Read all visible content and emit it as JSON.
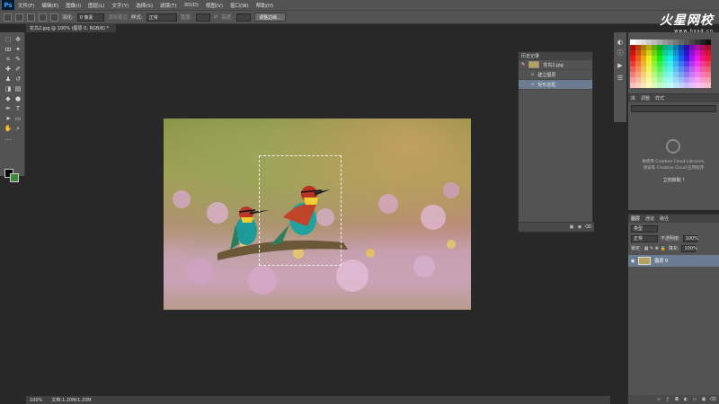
{
  "app": {
    "logo": "Ps"
  },
  "menu": [
    "文件(F)",
    "编辑(E)",
    "图像(I)",
    "图层(L)",
    "文字(Y)",
    "选择(S)",
    "滤镜(T)",
    "3D(D)",
    "视图(V)",
    "窗口(W)",
    "帮助(H)"
  ],
  "options": {
    "feather_label": "羽化:",
    "feather_value": "0 像素",
    "antialias_label": "消除锯齿",
    "style_label": "样式:",
    "style_value": "正常",
    "width_label": "宽度:",
    "height_label": "高度:",
    "refine_button": "调整边缘..."
  },
  "watermark": {
    "title": "火星网校",
    "url": "www.hxsd.cn"
  },
  "document": {
    "tab_title": "花鸟2.jpg @ 100% (图层 0, RGB/8) *"
  },
  "status": {
    "zoom": "100%",
    "doc_info": "文档:1.20M/1.20M"
  },
  "history": {
    "tab": "历史记录",
    "rows": [
      {
        "label": "花鸟2.jpg"
      },
      {
        "label": "建立图层"
      },
      {
        "label": "矩形选框"
      }
    ]
  },
  "libraries": {
    "tabs": [
      "库",
      "调整",
      "样式"
    ],
    "text1": "要使用 Creative Cloud Libraries,",
    "text2": "请安装 Creative Cloud 应用程序",
    "link": "立刻获取 !"
  },
  "layers": {
    "tabs": [
      "图层",
      "通道",
      "路径"
    ],
    "kind_value": "类型",
    "blend_value": "正常",
    "opacity_label": "不透明度:",
    "opacity_value": "100%",
    "lock_label": "锁定:",
    "fill_label": "填充:",
    "fill_value": "100%",
    "layer_name": "图层 0"
  },
  "colors": {
    "foreground": "#000000",
    "background": "#3e8a3d",
    "selection_highlight": "#6b7c92"
  },
  "icons": [
    "move-icon",
    "marquee-icon",
    "lasso-icon",
    "magic-wand-icon",
    "crop-icon",
    "eyedropper-icon",
    "healing-icon",
    "brush-icon",
    "stamp-icon",
    "history-brush-icon",
    "eraser-icon",
    "gradient-icon",
    "blur-icon",
    "dodge-icon",
    "pen-icon",
    "type-icon",
    "path-select-icon",
    "shape-icon",
    "hand-icon",
    "zoom-icon"
  ]
}
